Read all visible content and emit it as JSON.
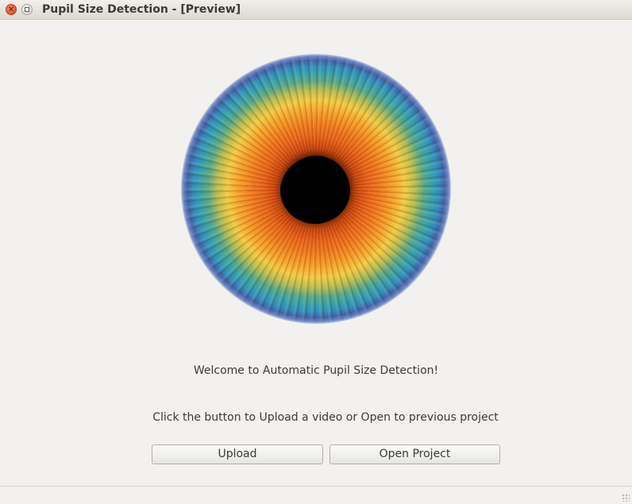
{
  "window": {
    "title": "Pupil Size Detection - [Preview]",
    "close_glyph": "×"
  },
  "main": {
    "welcome_text": "Welcome to Automatic Pupil Size Detection!",
    "instruction_text": "Click the button to Upload a video or Open to previous project",
    "upload_label": "Upload",
    "open_project_label": "Open Project"
  },
  "icons": {
    "close": "close-icon",
    "maximize": "maximize-icon",
    "resize": "resize-grip-icon"
  },
  "colors": {
    "background": "#f2f1f0",
    "close_button": "#e2542c",
    "text": "#3c3b37"
  }
}
